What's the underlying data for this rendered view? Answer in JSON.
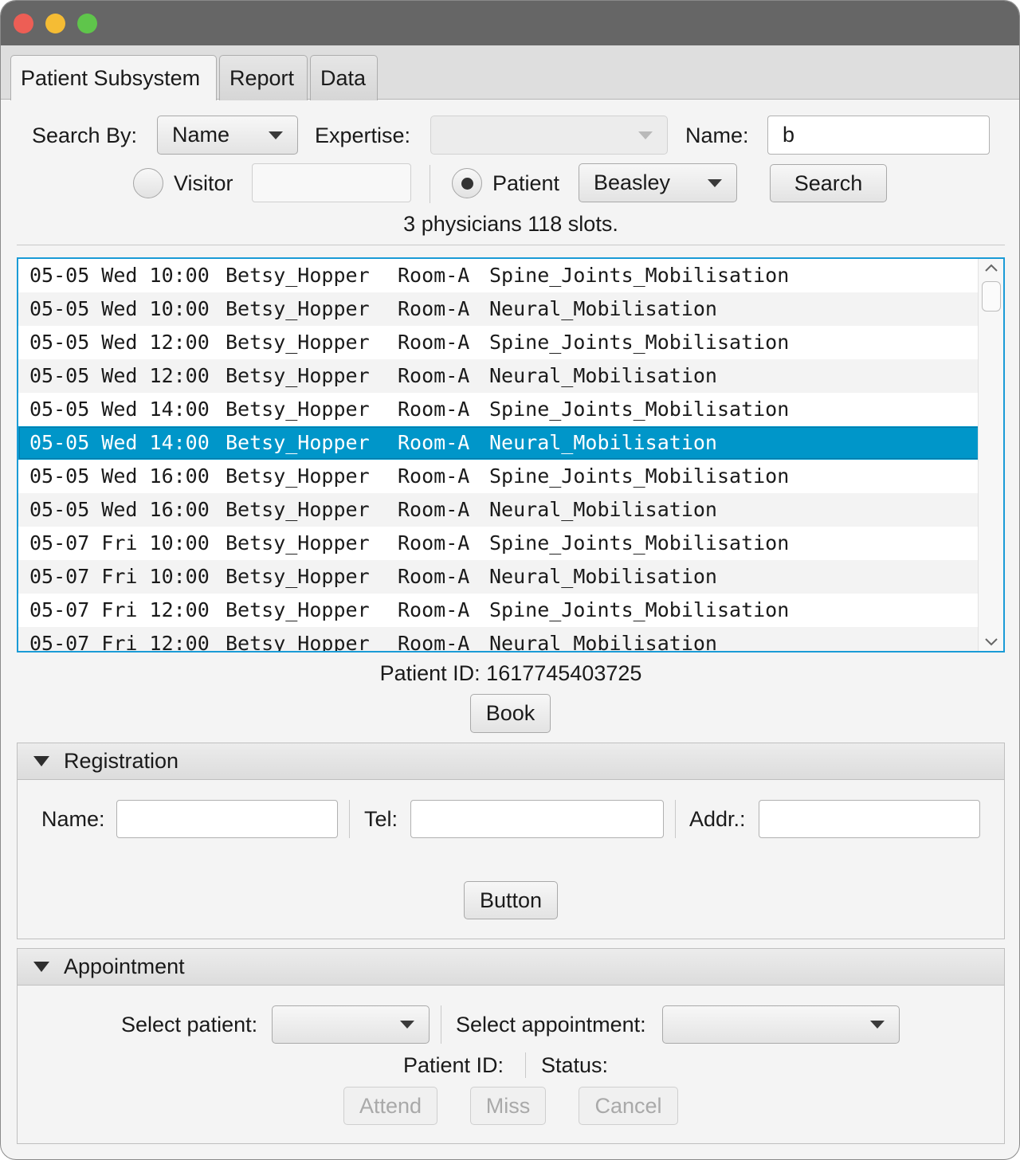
{
  "window": {
    "controls": [
      "close",
      "minimize",
      "zoom"
    ]
  },
  "tabs": [
    {
      "label": "Patient Subsystem",
      "active": true
    },
    {
      "label": "Report",
      "active": false
    },
    {
      "label": "Data",
      "active": false
    }
  ],
  "search": {
    "search_by_label": "Search By:",
    "search_by_value": "Name",
    "expertise_label": "Expertise:",
    "expertise_value": "",
    "name_label": "Name:",
    "name_value": "b",
    "visitor_label": "Visitor",
    "visitor_value": "",
    "patient_label": "Patient",
    "patient_value": "Beasley",
    "search_button": "Search",
    "status": "3 physicians 118 slots."
  },
  "slots": [
    [
      "05-05 Wed 10:00",
      "Betsy_Hopper",
      "Room-A",
      "Spine_Joints_Mobilisation"
    ],
    [
      "05-05 Wed 10:00",
      "Betsy_Hopper",
      "Room-A",
      "Neural_Mobilisation"
    ],
    [
      "05-05 Wed 12:00",
      "Betsy_Hopper",
      "Room-A",
      "Spine_Joints_Mobilisation"
    ],
    [
      "05-05 Wed 12:00",
      "Betsy_Hopper",
      "Room-A",
      "Neural_Mobilisation"
    ],
    [
      "05-05 Wed 14:00",
      "Betsy_Hopper",
      "Room-A",
      "Spine_Joints_Mobilisation"
    ],
    [
      "05-05 Wed 14:00",
      "Betsy_Hopper",
      "Room-A",
      "Neural_Mobilisation"
    ],
    [
      "05-05 Wed 16:00",
      "Betsy_Hopper",
      "Room-A",
      "Spine_Joints_Mobilisation"
    ],
    [
      "05-05 Wed 16:00",
      "Betsy_Hopper",
      "Room-A",
      "Neural_Mobilisation"
    ],
    [
      "05-07 Fri 10:00",
      "Betsy_Hopper",
      "Room-A",
      "Spine_Joints_Mobilisation"
    ],
    [
      "05-07 Fri 10:00",
      "Betsy_Hopper",
      "Room-A",
      "Neural_Mobilisation"
    ],
    [
      "05-07 Fri 12:00",
      "Betsy_Hopper",
      "Room-A",
      "Spine_Joints_Mobilisation"
    ],
    [
      "05-07 Fri 12:00",
      "Betsy_Hopper",
      "Room-A",
      "Neural_Mobilisation"
    ]
  ],
  "selected_slot_index": 5,
  "patient_id_text": "Patient ID: 1617745403725",
  "book_button": "Book",
  "registration": {
    "title": "Registration",
    "name_label": "Name:",
    "name_value": "",
    "tel_label": "Tel:",
    "tel_value": "",
    "addr_label": "Addr.:",
    "addr_value": "",
    "button": "Button"
  },
  "appointment": {
    "title": "Appointment",
    "select_patient_label": "Select patient:",
    "select_patient_value": "",
    "select_appointment_label": "Select appointment:",
    "select_appointment_value": "",
    "patient_id_label": "Patient ID:",
    "status_label": "Status:",
    "attend_button": "Attend",
    "miss_button": "Miss",
    "cancel_button": "Cancel"
  },
  "colors": {
    "selection": "#0096c9",
    "focus_border": "#1a9bd6",
    "close": "#ed5e55",
    "minimize": "#f5bc34",
    "zoom": "#5fc54b"
  }
}
